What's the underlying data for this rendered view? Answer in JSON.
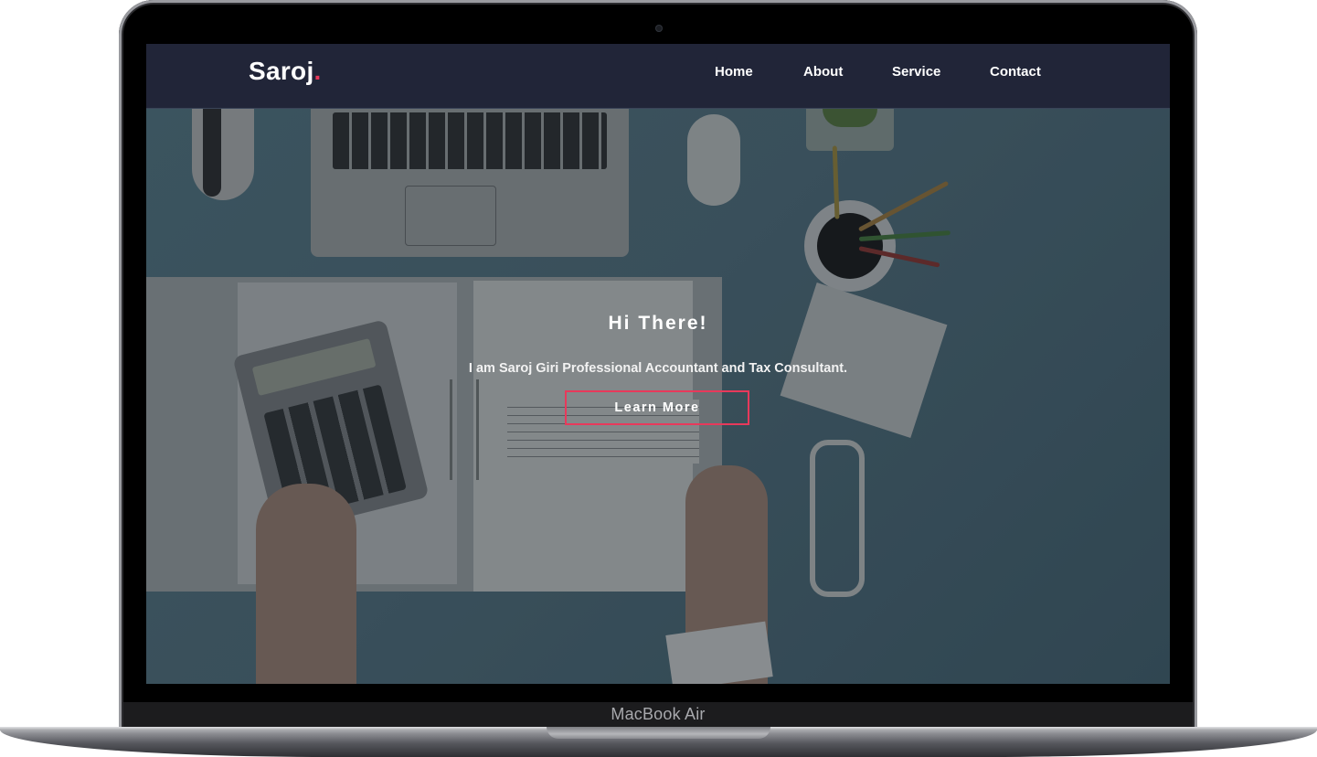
{
  "device": {
    "label": "MacBook Air"
  },
  "brand": {
    "name": "Saroj",
    "dot": ".",
    "accent_color": "#e8395b"
  },
  "nav": {
    "items": [
      {
        "label": "Home"
      },
      {
        "label": "About"
      },
      {
        "label": "Service"
      },
      {
        "label": "Contact"
      }
    ]
  },
  "hero": {
    "title": "Hi There!",
    "subtitle": "I am Saroj Giri Professional Accountant and Tax Consultant.",
    "button_label": "Learn More"
  },
  "colors": {
    "navbar_bg": "#212538",
    "button_border": "#e8395b",
    "text": "#ffffff"
  }
}
